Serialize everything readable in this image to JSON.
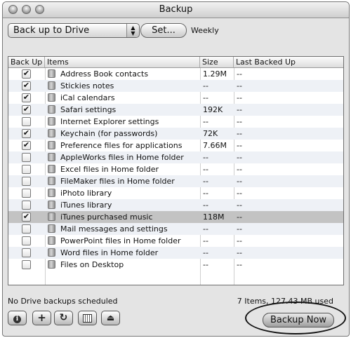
{
  "window": {
    "title": "Backup"
  },
  "toolbar": {
    "destination_value": "Back up to Drive",
    "set_label": "Set...",
    "schedule_text": "Weekly"
  },
  "table": {
    "headers": {
      "backup": "Back Up",
      "items": "Items",
      "size": "Size",
      "last": "Last Backed Up"
    },
    "rows": [
      {
        "checked": true,
        "item": "Address Book contacts",
        "size": "1.29M",
        "last": "--"
      },
      {
        "checked": true,
        "item": "Stickies notes",
        "size": "--",
        "last": "--"
      },
      {
        "checked": true,
        "item": "iCal calendars",
        "size": "--",
        "last": "--"
      },
      {
        "checked": true,
        "item": "Safari settings",
        "size": "192K",
        "last": "--"
      },
      {
        "checked": false,
        "item": "Internet Explorer settings",
        "size": "--",
        "last": "--"
      },
      {
        "checked": true,
        "item": "Keychain (for passwords)",
        "size": "72K",
        "last": "--"
      },
      {
        "checked": true,
        "item": "Preference files for applications",
        "size": "7.66M",
        "last": "--"
      },
      {
        "checked": false,
        "item": "AppleWorks files in Home folder",
        "size": "--",
        "last": "--"
      },
      {
        "checked": false,
        "item": "Excel files in Home folder",
        "size": "--",
        "last": "--"
      },
      {
        "checked": false,
        "item": "FileMaker files in Home folder",
        "size": "--",
        "last": "--"
      },
      {
        "checked": false,
        "item": "iPhoto library",
        "size": "--",
        "last": "--"
      },
      {
        "checked": false,
        "item": "iTunes library",
        "size": "--",
        "last": "--"
      },
      {
        "checked": true,
        "item": "iTunes purchased music",
        "size": "118M",
        "last": "--",
        "selected": true
      },
      {
        "checked": false,
        "item": "Mail messages and settings",
        "size": "--",
        "last": "--"
      },
      {
        "checked": false,
        "item": "PowerPoint files in Home folder",
        "size": "--",
        "last": "--"
      },
      {
        "checked": false,
        "item": "Word files in Home folder",
        "size": "--",
        "last": "--"
      },
      {
        "checked": false,
        "item": "Files on Desktop",
        "size": "--",
        "last": "--"
      }
    ]
  },
  "status": {
    "left": "No Drive backups scheduled",
    "right": "7 Items, 127.43 MB used"
  },
  "bottom_buttons": {
    "info_icon": "info-icon",
    "add_icon": "plus-icon",
    "refresh_icon": "refresh-icon",
    "calendar_icon": "calendar-icon",
    "eject_icon": "eject-icon",
    "backup_now_label": "Backup Now"
  }
}
